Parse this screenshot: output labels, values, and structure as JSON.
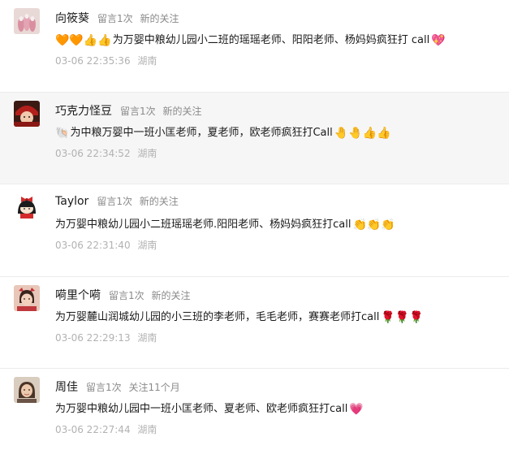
{
  "comments": [
    {
      "name": "向筱葵",
      "msg_count": "留言1次",
      "follow": "新的关注",
      "emoji_before": "🧡🧡👍👍",
      "text": "为万婴中粮幼儿园小二班的瑶瑶老师、阳阳老师、杨妈妈疯狂打 call",
      "emoji_after": "💖",
      "time": "03-06 22:35:36",
      "location": "湖南",
      "avatar": "nails-photo-icon"
    },
    {
      "name": "巧克力怪豆",
      "msg_count": "留言1次",
      "follow": "新的关注",
      "emoji_before": "🐚",
      "text": "为中粮万婴中一班小匡老师，夏老师，欧老师疯狂打Call",
      "emoji_after": "🤚🤚👍👍",
      "time": "03-06 22:34:52",
      "location": "湖南",
      "avatar": "girl-red-hat-icon"
    },
    {
      "name": "Taylor",
      "msg_count": "留言1次",
      "follow": "新的关注",
      "emoji_before": "",
      "text": "为万婴中粮幼儿园小二班瑶瑶老师.阳阳老师、杨妈妈疯狂打call",
      "emoji_after": "👏👏👏",
      "time": "03-06 22:31:40",
      "location": "湖南",
      "avatar": "cartoon-bow-girl-icon"
    },
    {
      "name": "嗬里个嗬",
      "msg_count": "留言1次",
      "follow": "新的关注",
      "emoji_before": "",
      "text": "为万婴麓山润城幼儿园的小三班的李老师，毛毛老师，赛赛老师打call",
      "emoji_after": "🌹🌹🌹",
      "time": "03-06 22:29:13",
      "location": "湖南",
      "avatar": "child-photo-icon"
    },
    {
      "name": "周佳",
      "msg_count": "留言1次",
      "follow": "关注11个月",
      "emoji_before": "",
      "text": "为万婴中粮幼儿园中一班小匡老师、夏老师、欧老师疯狂打call",
      "emoji_after": "💗",
      "time": "03-06 22:27:44",
      "location": "湖南",
      "avatar": "woman-photo-icon"
    }
  ],
  "colors": {
    "name": "#1a1a1a",
    "meta": "#8a8a8a",
    "time": "#b2b2b2",
    "highlight_bg": "#f6f6f6"
  }
}
